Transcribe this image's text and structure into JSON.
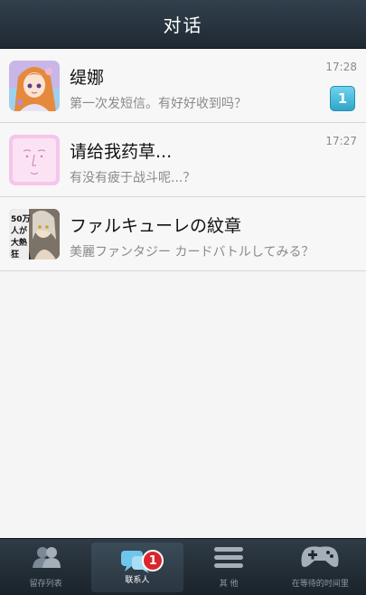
{
  "header": {
    "title": "对话"
  },
  "conversations": [
    {
      "name": "缇娜",
      "preview": "第一次发短信。有好好收到吗？",
      "time": "17:28",
      "unread": "1",
      "avatar_icon": "anime-girl-avatar"
    },
    {
      "name": "请给我药草...",
      "preview": "有没有疲于战斗呢...？",
      "time": "17:27",
      "avatar_icon": "pink-sketch-face-avatar"
    },
    {
      "name": "ファルキューレの紋章",
      "preview": "美麗ファンタジー カードバトルしてみる？",
      "time": "",
      "avatar_icon": "game-promo-avatar",
      "avatar_text": "50万人が大熱狂"
    }
  ],
  "tabbar": {
    "tabs": [
      {
        "label": "留存列表",
        "icon": "people-icon"
      },
      {
        "label": "联系人",
        "icon": "chat-bubbles-icon",
        "badge": "1",
        "active": true
      },
      {
        "label": "其 他",
        "icon": "menu-lines-icon"
      },
      {
        "label": "在等待的时间里",
        "icon": "gamepad-icon"
      }
    ]
  },
  "colors": {
    "header_bg": "#28333d",
    "badge_blue": "#3bb4d8",
    "tab_badge_red": "#d9262c"
  }
}
